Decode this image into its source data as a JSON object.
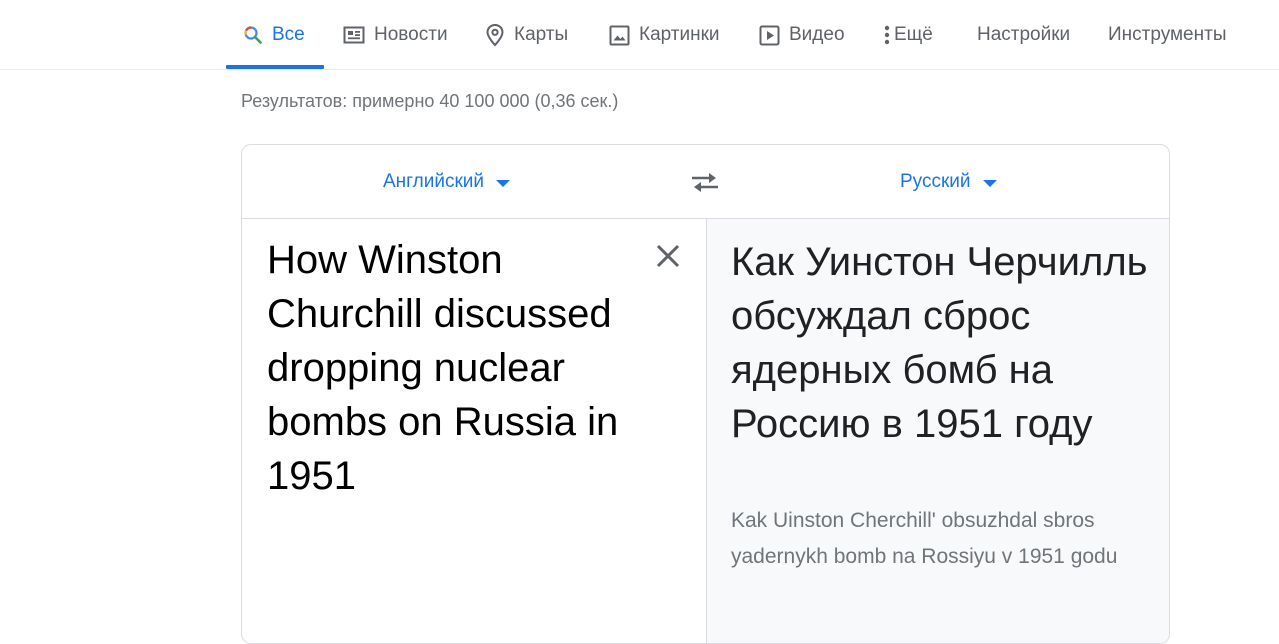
{
  "nav": {
    "tabs": [
      {
        "label": "Все",
        "icon": "search-icon"
      },
      {
        "label": "Новости",
        "icon": "news-icon"
      },
      {
        "label": "Карты",
        "icon": "map-pin-icon"
      },
      {
        "label": "Картинки",
        "icon": "image-icon"
      },
      {
        "label": "Видео",
        "icon": "video-icon"
      },
      {
        "label": "Ещё",
        "icon": "more-vert-icon"
      },
      {
        "label": "Настройки"
      },
      {
        "label": "Инструменты"
      }
    ],
    "active": "Все"
  },
  "stats": "Результатов: примерно 40 100 000 (0,36 сек.)",
  "translate": {
    "source_lang": "Английский",
    "target_lang": "Русский",
    "source_text": "How Winston Churchill discussed dropping nuclear bombs on Russia in 1951",
    "target_text": "Как Уинстон Черчилль обсуждал сброс ядерных бомб на Россию в 1951 году",
    "transliteration": "Kak Uinston Cherchill' obsuzhdal sbros yadernykh bomb na Rossiyu v 1951 godu"
  },
  "colors": {
    "accent": "#1a73e8",
    "tab_text": "#5f6368",
    "muted_text": "#70757a",
    "border": "#dadce0",
    "target_bg": "#f8f9fa"
  }
}
